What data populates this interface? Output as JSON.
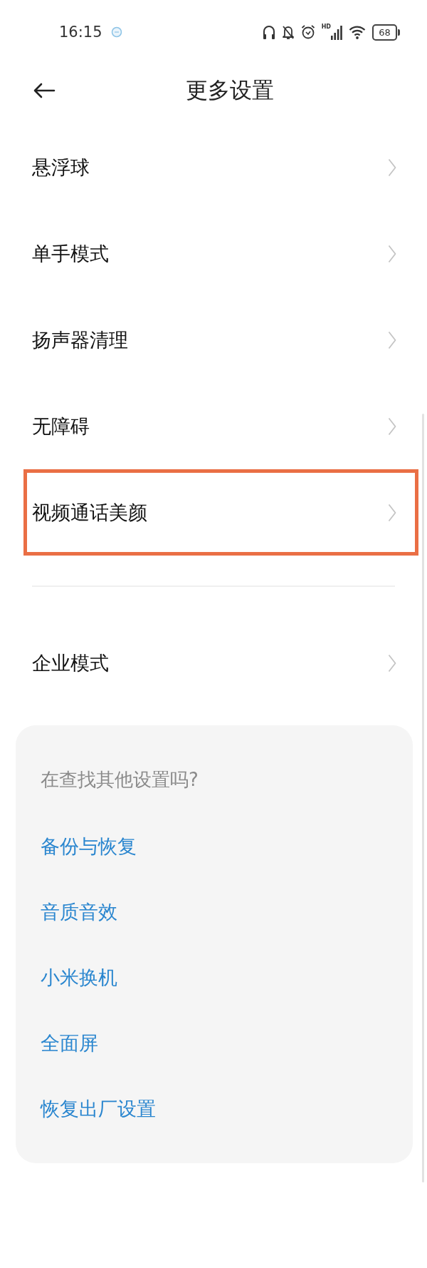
{
  "status_bar": {
    "time": "16:15",
    "network_label": "HD",
    "battery": "68"
  },
  "header": {
    "title": "更多设置"
  },
  "settings_groups": [
    {
      "items": [
        {
          "label": "悬浮球",
          "highlighted": false
        },
        {
          "label": "单手模式",
          "highlighted": false
        },
        {
          "label": "扬声器清理",
          "highlighted": false
        },
        {
          "label": "无障碍",
          "highlighted": false
        },
        {
          "label": "视频通话美颜",
          "highlighted": true
        }
      ]
    },
    {
      "items": [
        {
          "label": "企业模式",
          "highlighted": false
        }
      ]
    }
  ],
  "suggestions": {
    "prompt": "在查找其他设置吗?",
    "links": [
      "备份与恢复",
      "音质音效",
      "小米换机",
      "全面屏",
      "恢复出厂设置"
    ]
  }
}
